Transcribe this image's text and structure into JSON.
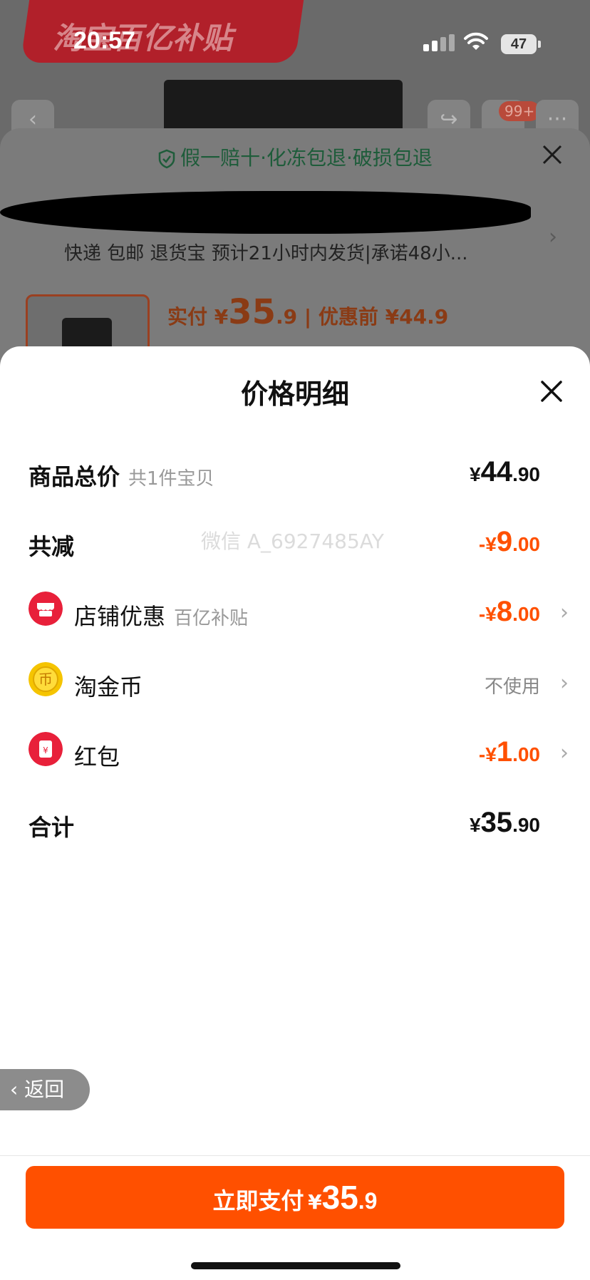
{
  "status_bar": {
    "time": "20:57",
    "battery": "47"
  },
  "background": {
    "banner": "淘宝百亿补贴",
    "cart_badge": "99+",
    "guarantee": "假一赔十·化冻包退·破损包退",
    "delivery": "快递 包邮 退货宝 预计21小时内发货|承诺48小...",
    "paid_label": "实付 ¥",
    "paid_int": "35",
    "paid_dec": ".9",
    "before_label": " | 优惠前 ¥44.9"
  },
  "modal": {
    "title": "价格明细",
    "rows": [
      {
        "label": "商品总价",
        "sub": "共1件宝贝",
        "cur": "¥",
        "int": "44",
        "dec": ".90"
      },
      {
        "label": "共减",
        "cur": "-¥",
        "int": "9",
        "dec": ".00"
      },
      {
        "label": "店铺优惠",
        "sub": "百亿补贴",
        "cur": "-¥",
        "int": "8",
        "dec": ".00"
      },
      {
        "label": "淘金币",
        "value_text": "不使用"
      },
      {
        "label": "红包",
        "cur": "-¥",
        "int": "1",
        "dec": ".00"
      },
      {
        "label": "合计",
        "cur": "¥",
        "int": "35",
        "dec": ".90"
      }
    ],
    "watermark": "微信 A_6927485AY"
  },
  "back_button": "返回",
  "pay_button": {
    "label": "立即支付",
    "cur": "¥",
    "int": "35",
    "dec": ".9"
  },
  "colors": {
    "accent": "#ff5000",
    "green": "#1e5c3a"
  },
  "icons": [
    "shield-check-icon",
    "close-icon",
    "shop-icon",
    "coin-icon",
    "red-packet-icon",
    "chevron-right-icon",
    "chevron-left-icon"
  ]
}
